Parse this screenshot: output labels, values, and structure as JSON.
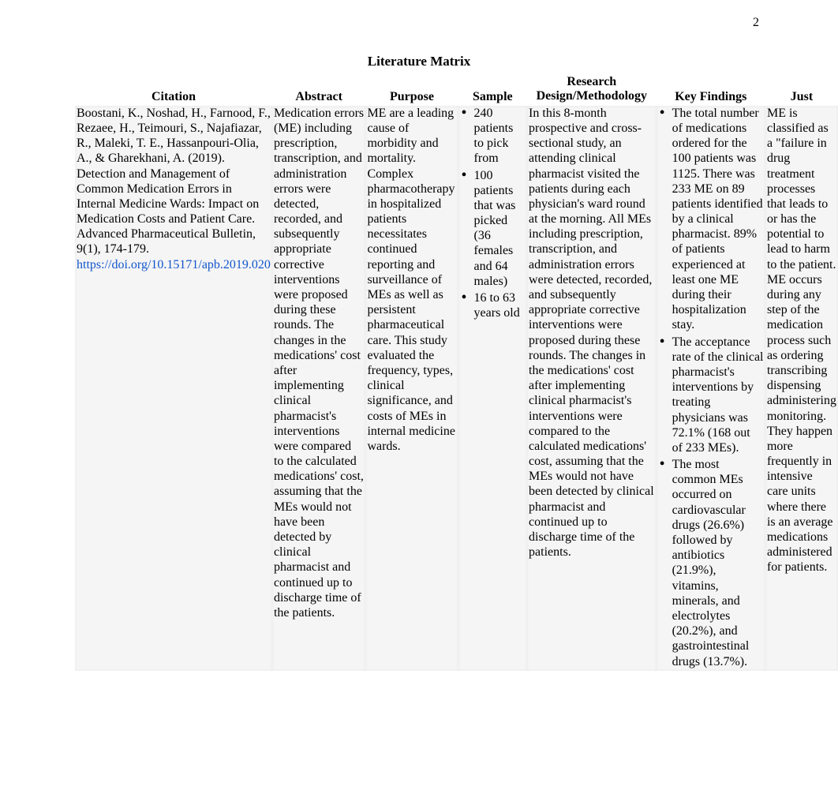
{
  "page_number": "2",
  "title": "Literature Matrix",
  "headers": {
    "citation": "Citation",
    "abstract": "Abstract",
    "purpose": "Purpose",
    "sample": "Sample",
    "methodology_line1": "Research",
    "methodology_line2": "Design/Methodology",
    "findings": "Key Findings",
    "justification": "Just"
  },
  "row": {
    "citation_text": "Boostani, K., Noshad, H., Farnood, F., Rezaee, H., Teimouri, S., Najafiazar, R., Maleki, T. E., Hassanpouri-Olia, A., & Gharekhani, A. (2019). Detection and Management of Common Medication Errors in Internal Medicine Wards: Impact on Medication Costs and Patient Care. Advanced Pharmaceutical Bulletin, 9(1), 174-179. ",
    "citation_link": "https://doi.org/10.15171/apb.2019.020",
    "abstract": "Medication errors (ME) including prescription, transcription, and administration errors were detected, recorded, and subsequently appropriate corrective interventions were proposed during these rounds. The changes in the medications' cost after implementing clinical pharmacist's interventions were compared to the calculated medications' cost, assuming that the MEs would not have been detected by clinical pharmacist and continued up to discharge time of the patients.",
    "purpose": "ME are a leading cause of morbidity and mortality. Complex pharmacotherapy in hospitalized patients necessitates continued reporting and surveillance of MEs as well as persistent pharmaceutical care. This study evaluated the frequency, types, clinical significance, and costs of MEs in internal medicine wards.",
    "sample": [
      "240 patients to pick from",
      "100 patients that was picked (36 females and 64 males)",
      "16 to 63 years old"
    ],
    "methodology": "In this 8-month prospective and cross-sectional study, an attending clinical pharmacist visited the patients during each physician's ward round at the morning. All MEs including prescription, transcription, and administration errors were detected, recorded, and subsequently appropriate corrective interventions were proposed during these rounds. The changes in the medications' cost after implementing clinical pharmacist's interventions were compared to the calculated medications' cost, assuming that the MEs would not have been detected by clinical pharmacist and continued up to discharge time of the patients.",
    "findings": [
      "The total number of medications ordered for the 100 patients was 1125. There was 233 ME on 89 patients identified by a clinical pharmacist. 89% of patients experienced at least one ME during their hospitalization stay.",
      "The acceptance rate of the clinical pharmacist's interventions by treating physicians was 72.1% (168 out of 233 MEs).",
      "The most common MEs occurred on cardiovascular drugs (26.6%) followed by antibiotics (21.9%), vitamins, minerals, and electrolytes (20.2%), and gastrointestinal drugs (13.7%)."
    ],
    "justification": "ME is classified as a \"failure in drug treatment processes that leads to or has the potential to lead to harm to the patient. ME occurs during any step of the medication process such as ordering transcribing dispensing administering monitoring. They happen more frequently in intensive care units where there is an average medications administered for patients."
  }
}
